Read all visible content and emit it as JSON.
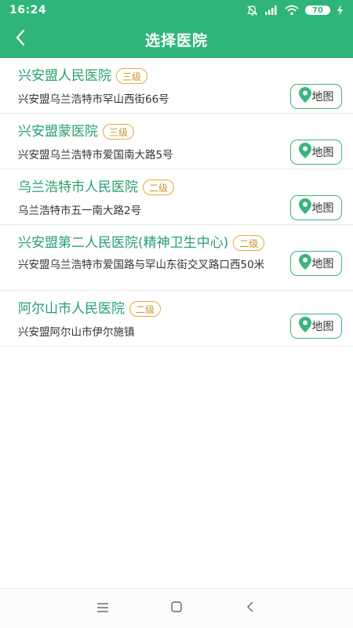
{
  "status_bar": {
    "time": "16:24",
    "battery": "70",
    "icons": [
      "alarm-off-icon",
      "signal-icon",
      "wifi-icon",
      "battery-icon",
      "charging-icon"
    ]
  },
  "app_bar": {
    "title": "选择医院",
    "back_icon": "back-arrow-icon"
  },
  "colors": {
    "primary": "#2fb57a",
    "hospital_name": "#27a06d",
    "level_badge": "#c8962a",
    "text": "#333333"
  },
  "hospitals": [
    {
      "name": "兴安盟人民医院",
      "level": "三级",
      "address": "兴安盟乌兰浩特市罕山西街66号",
      "map_label": "地图"
    },
    {
      "name": "兴安盟蒙医院",
      "level": "三级",
      "address": "兴安盟乌兰浩特市爱国南大路5号",
      "map_label": "地图"
    },
    {
      "name": "乌兰浩特市人民医院",
      "level": "二级",
      "address": "乌兰浩特市五一南大路2号",
      "map_label": "地图"
    },
    {
      "name": "兴安盟第二人民医院(精神卫生中心)",
      "level": "二级",
      "address": "兴安盟乌兰浩特市爱国路与罕山东街交叉路口西50米",
      "map_label": "地图"
    },
    {
      "name": "阿尔山市人民医院",
      "level": "二级",
      "address": "兴安盟阿尔山市伊尔施镇",
      "map_label": "地图"
    }
  ],
  "nav_bar": {
    "icons": [
      "menu-icon",
      "home-square-icon",
      "back-triangle-icon"
    ]
  }
}
